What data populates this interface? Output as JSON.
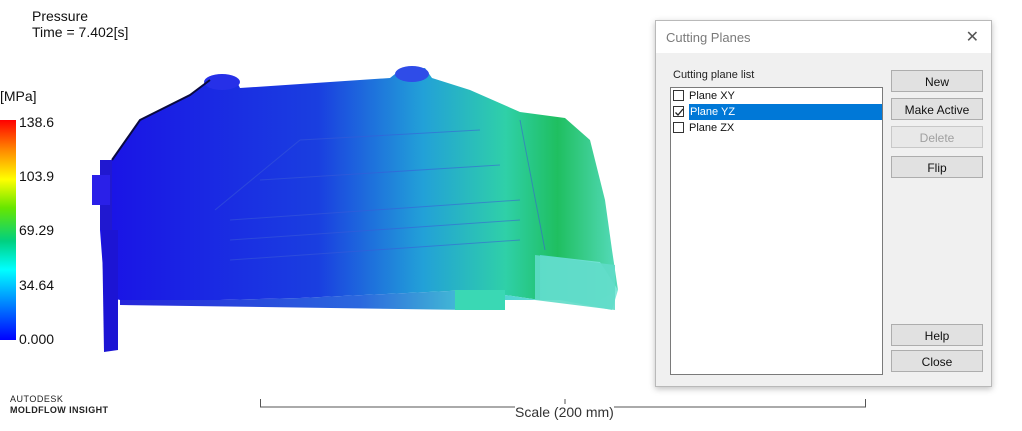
{
  "result": {
    "quantity": "Pressure",
    "time": "Time = 7.402[s]",
    "unit": "[MPa]"
  },
  "colorbar": {
    "ticks": [
      "138.6",
      "103.9",
      "69.29",
      "34.64",
      "0.000"
    ],
    "colors": [
      "#ff0000",
      "#ffff00",
      "#00d080",
      "#00ffff",
      "#0000ff"
    ]
  },
  "branding": {
    "line1": "AUTODESK",
    "line2": "MOLDFLOW INSIGHT"
  },
  "scale": {
    "label": "Scale (200 mm)"
  },
  "dialog": {
    "title": "Cutting Planes",
    "close_icon": "close-icon",
    "list_label": "Cutting plane list",
    "planes": [
      {
        "label": "Plane XY",
        "checked": false,
        "selected": false
      },
      {
        "label": "Plane YZ",
        "checked": true,
        "selected": true
      },
      {
        "label": "Plane ZX",
        "checked": false,
        "selected": false
      }
    ],
    "buttons": {
      "new": "New",
      "make_active": "Make Active",
      "delete": "Delete",
      "flip": "Flip",
      "help": "Help",
      "close": "Close"
    }
  }
}
